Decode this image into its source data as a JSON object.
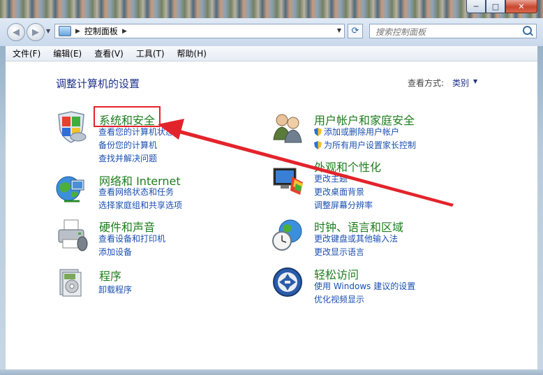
{
  "window": {
    "controls": {
      "minimize": "─",
      "maximize": "□",
      "close": "✕"
    }
  },
  "nav": {
    "back_icon": "left-arrow-icon",
    "forward_icon": "right-arrow-icon",
    "breadcrumb": "控制面板",
    "search_placeholder": "搜索控制面板"
  },
  "menu": [
    "文件(F)",
    "编辑(E)",
    "查看(V)",
    "工具(T)",
    "帮助(H)"
  ],
  "main": {
    "title": "调整计算机的设置",
    "view_by_label": "查看方式:",
    "view_by_value": "类别"
  },
  "categories_left": [
    {
      "icon": "security-shield-icon",
      "title": "系统和安全",
      "links": [
        "查看您的计算机状态",
        "备份您的计算机",
        "查找并解决问题"
      ]
    },
    {
      "icon": "network-globe-icon",
      "title": "网络和 Internet",
      "links": [
        "查看网络状态和任务",
        "选择家庭组和共享选项"
      ]
    },
    {
      "icon": "printer-icon",
      "title": "硬件和声音",
      "links": [
        "查看设备和打印机",
        "添加设备"
      ]
    },
    {
      "icon": "programs-icon",
      "title": "程序",
      "links": [
        "卸载程序"
      ]
    }
  ],
  "categories_right": [
    {
      "icon": "users-icon",
      "title": "用户帐户和家庭安全",
      "links": [
        "添加或删除用户帐户",
        "为所有用户设置家长控制"
      ]
    },
    {
      "icon": "appearance-monitor-icon",
      "title": "外观和个性化",
      "links": [
        "更改主题",
        "更改桌面背景",
        "调整屏幕分辨率"
      ]
    },
    {
      "icon": "clock-globe-icon",
      "title": "时钟、语言和区域",
      "links": [
        "更改键盘或其他输入法",
        "更改显示语言"
      ]
    },
    {
      "icon": "ease-of-access-icon",
      "title": "轻松访问",
      "links": [
        "使用 Windows 建议的设置",
        "优化视频显示"
      ]
    }
  ],
  "colors": {
    "category_title": "#1d7d1d",
    "link": "#1a4fb0",
    "annotation": "#e3232b"
  }
}
